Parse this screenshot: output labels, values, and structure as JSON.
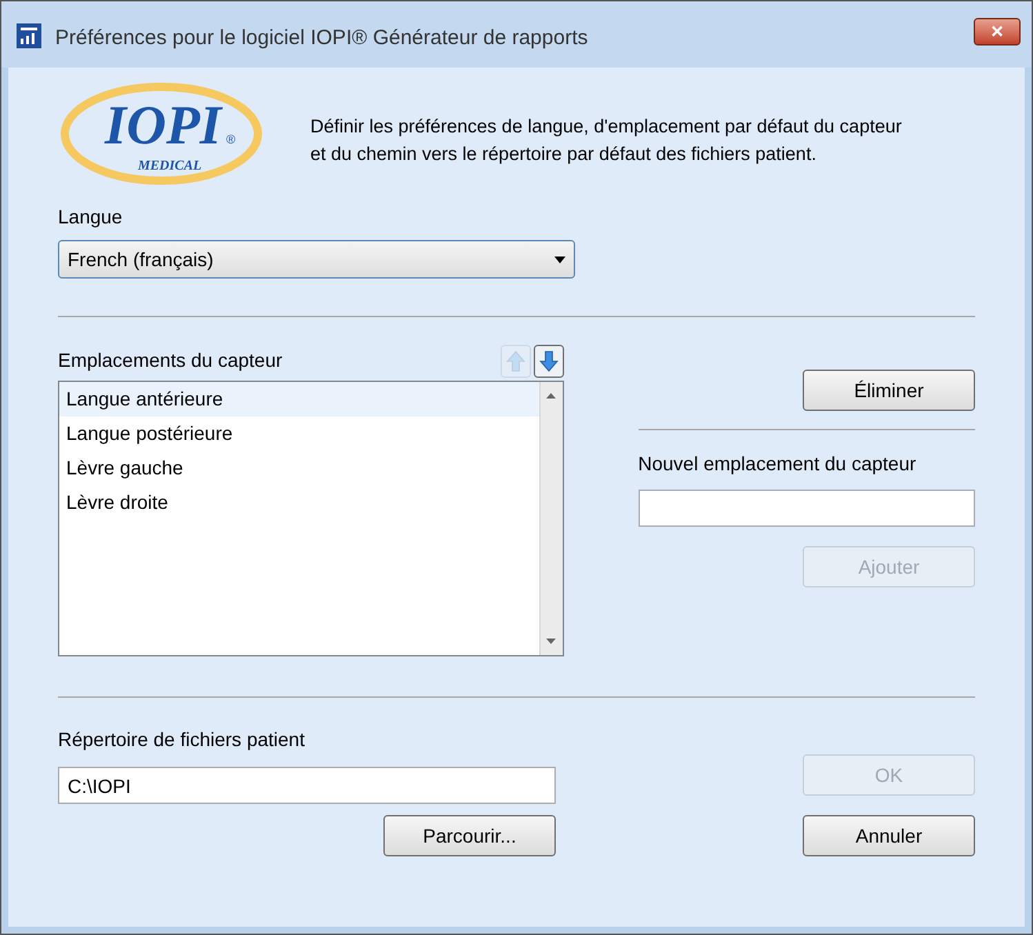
{
  "window": {
    "title": "Préférences pour le logiciel IOPI® Générateur de rapports",
    "close": "✕"
  },
  "logo": {
    "name": "IOPI",
    "registered": "®",
    "sub": "MEDICAL"
  },
  "intro": "Définir les préférences de langue, d'emplacement par défaut du capteur et du chemin vers le répertoire par défaut des fichiers patient.",
  "language": {
    "label": "Langue",
    "value": "French (français)"
  },
  "locations": {
    "label": "Emplacements du capteur",
    "move_up": {
      "disabled": true
    },
    "move_down": {
      "disabled": false
    },
    "items": [
      {
        "label": "Langue antérieure",
        "selected": true
      },
      {
        "label": "Langue postérieure",
        "selected": false
      },
      {
        "label": "Lèvre gauche",
        "selected": false
      },
      {
        "label": "Lèvre droite",
        "selected": false
      }
    ]
  },
  "remove_button": {
    "label": "Éliminer",
    "disabled": false
  },
  "new_location": {
    "label": "Nouvel emplacement du capteur"
  },
  "add_button": {
    "label": "Ajouter",
    "disabled": true
  },
  "directory": {
    "label": "Répertoire de fichiers patient",
    "value": "C:\\IOPI"
  },
  "browse_button": {
    "label": "Parcourir...",
    "disabled": false
  },
  "ok_button": {
    "label": "OK",
    "disabled": true
  },
  "cancel_button": {
    "label": "Annuler",
    "disabled": false
  }
}
